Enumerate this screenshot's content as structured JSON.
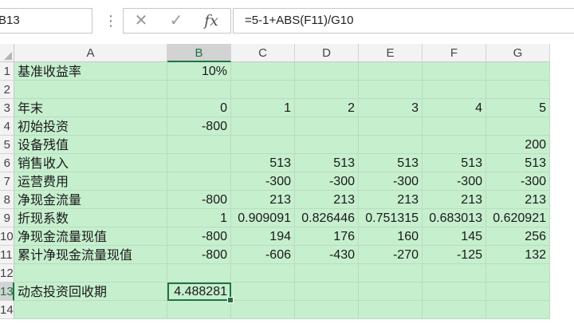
{
  "formula_bar": {
    "name_box": "B13",
    "cancel_icon": "cancel-x-icon",
    "enter_icon": "checkmark-icon",
    "fx_label": "fx",
    "formula": "=5-1+ABS(F11)/G10"
  },
  "colors": {
    "cell_fill": "#c6efce",
    "selection": "#217346",
    "header": "#f3f3f3"
  },
  "columns": [
    "A",
    "B",
    "C",
    "D",
    "E",
    "F",
    "G"
  ],
  "rows": [
    {
      "n": "1",
      "cells": [
        "基准收益率",
        "10%",
        "",
        "",
        "",
        "",
        ""
      ]
    },
    {
      "n": "2",
      "cells": [
        "",
        "",
        "",
        "",
        "",
        "",
        ""
      ]
    },
    {
      "n": "3",
      "cells": [
        "年末",
        "0",
        "1",
        "2",
        "3",
        "4",
        "5"
      ]
    },
    {
      "n": "4",
      "cells": [
        "初始投资",
        "-800",
        "",
        "",
        "",
        "",
        ""
      ]
    },
    {
      "n": "5",
      "cells": [
        "设备残值",
        "",
        "",
        "",
        "",
        "",
        "200"
      ]
    },
    {
      "n": "6",
      "cells": [
        "销售收入",
        "",
        "513",
        "513",
        "513",
        "513",
        "513"
      ]
    },
    {
      "n": "7",
      "cells": [
        "运营费用",
        "",
        "-300",
        "-300",
        "-300",
        "-300",
        "-300"
      ]
    },
    {
      "n": "8",
      "cells": [
        "净现金流量",
        "-800",
        "213",
        "213",
        "213",
        "213",
        "213"
      ]
    },
    {
      "n": "9",
      "cells": [
        "折现系数",
        "1",
        "0.909091",
        "0.826446",
        "0.751315",
        "0.683013",
        "0.620921"
      ]
    },
    {
      "n": "10",
      "cells": [
        "净现金流量现值",
        "-800",
        "194",
        "176",
        "160",
        "145",
        "256"
      ]
    },
    {
      "n": "11",
      "cells": [
        "累计净现金流量现值",
        "-800",
        "-606",
        "-430",
        "-270",
        "-125",
        "132"
      ]
    },
    {
      "n": "12",
      "cells": [
        "",
        "",
        "",
        "",
        "",
        "",
        ""
      ]
    },
    {
      "n": "13",
      "cells": [
        "动态投资回收期",
        "4.488281",
        "",
        "",
        "",
        "",
        ""
      ]
    },
    {
      "n": "14",
      "cells": [
        "",
        "",
        "",
        "",
        "",
        "",
        ""
      ]
    }
  ],
  "selection": {
    "column": "B",
    "row": "13"
  }
}
